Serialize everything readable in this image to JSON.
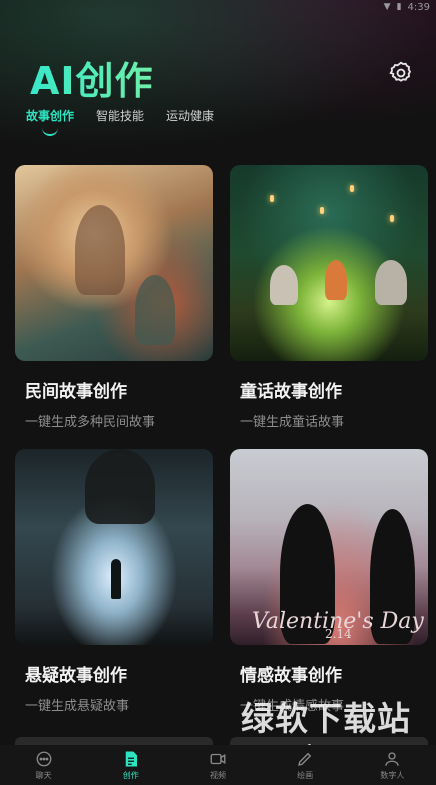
{
  "status_bar": {
    "time": "4:39"
  },
  "header": {
    "title": "AI创作"
  },
  "tabs": [
    {
      "label": "故事创作",
      "active": true
    },
    {
      "label": "智能技能",
      "active": false
    },
    {
      "label": "运动健康",
      "active": false
    }
  ],
  "cards": [
    {
      "title": "民间故事创作",
      "description": "一键生成多种民间故事"
    },
    {
      "title": "童话故事创作",
      "description": "一键生成童话故事"
    },
    {
      "title": "悬疑故事创作",
      "description": "一键生成悬疑故事"
    },
    {
      "title": "情感故事创作",
      "description": "一键生成情感故事",
      "image_text": "Valentine's Day",
      "image_date": "2.14"
    }
  ],
  "bottom_nav": [
    {
      "label": "聊天",
      "icon": "chat-bubble-icon",
      "active": false
    },
    {
      "label": "创作",
      "icon": "document-icon",
      "active": true
    },
    {
      "label": "视频",
      "icon": "video-icon",
      "active": false
    },
    {
      "label": "绘画",
      "icon": "paint-icon",
      "active": false
    },
    {
      "label": "数字人",
      "icon": "person-icon",
      "active": false
    }
  ],
  "watermark": {
    "main": "绿软下载站",
    "url": "www.itmop.com"
  },
  "colors": {
    "accent": "#2ee3c0",
    "background": "#121212",
    "muted_text": "#8d8d8d"
  }
}
